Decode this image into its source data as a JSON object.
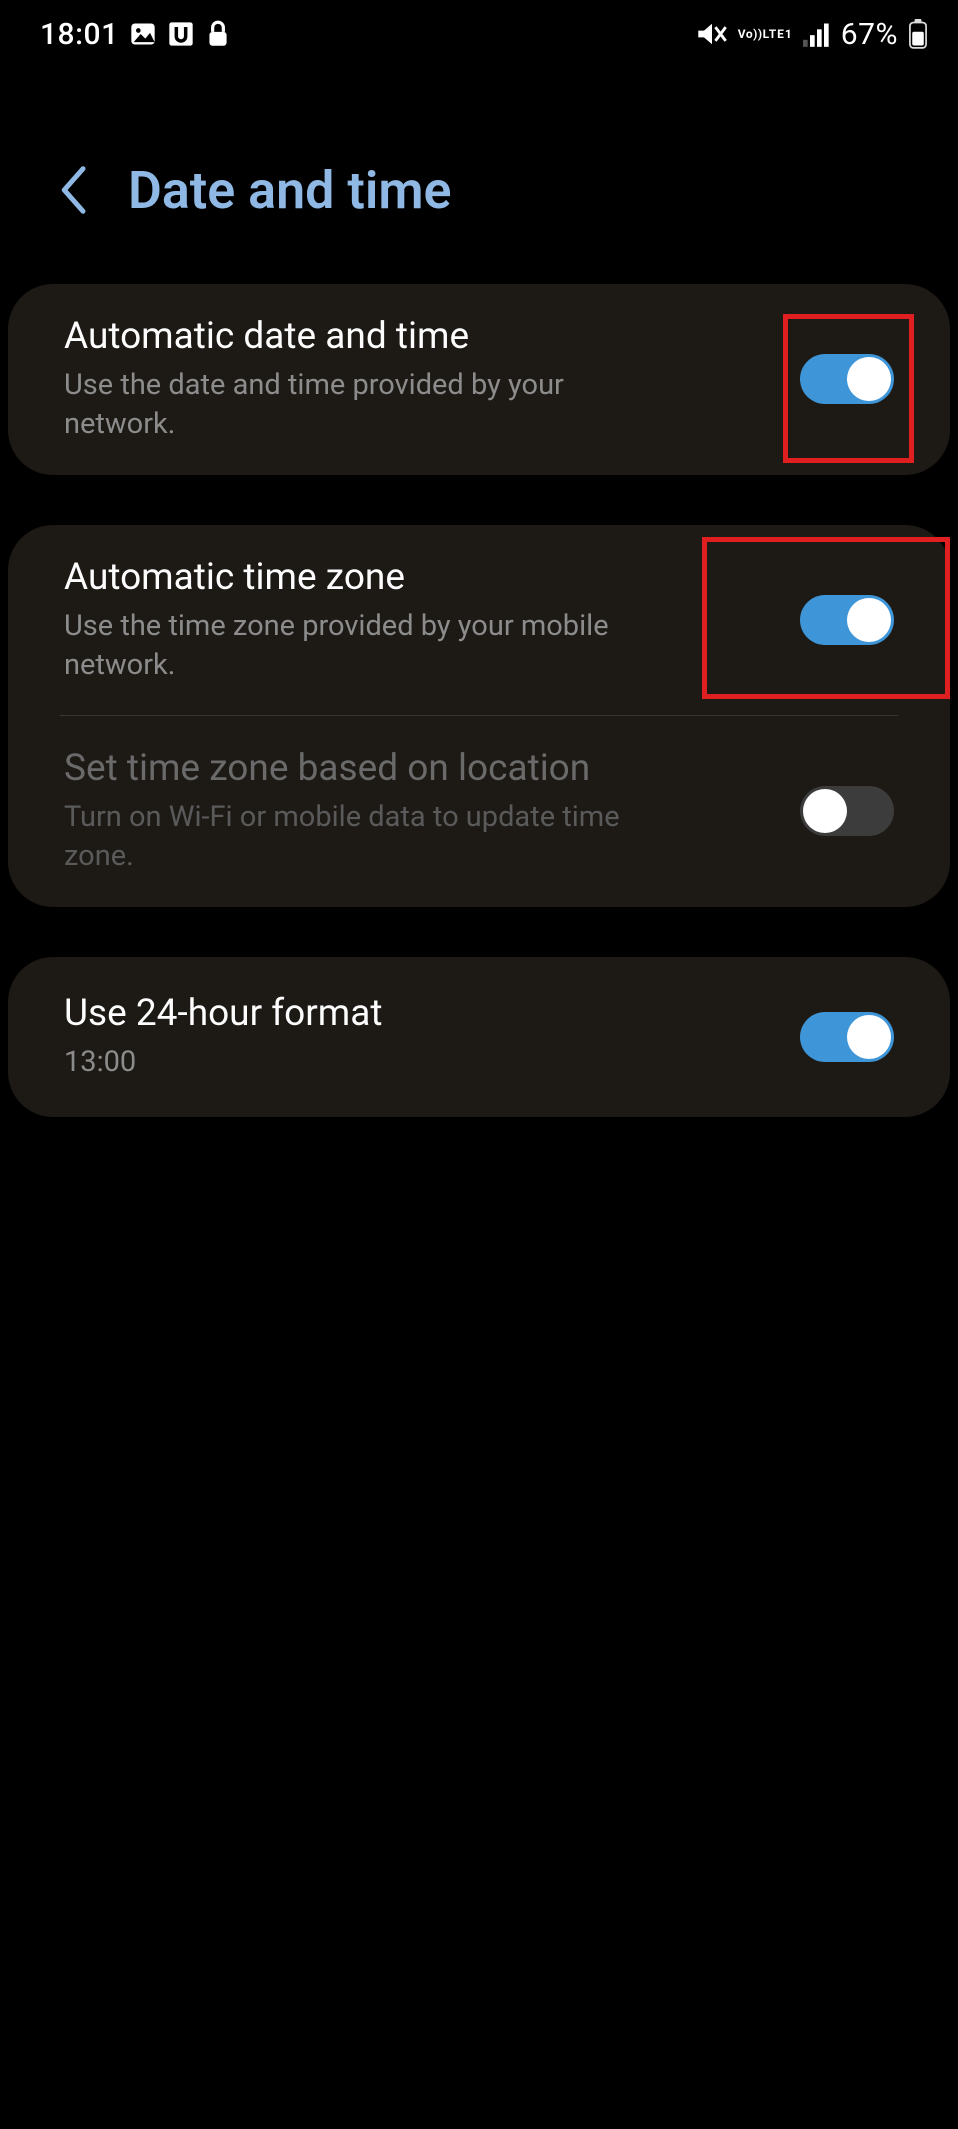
{
  "status": {
    "time": "18:01",
    "icons_left": [
      "picture-icon",
      "u-box-icon",
      "lock-icon"
    ],
    "icons_right": [
      "mute-icon",
      "volte-icon",
      "signal-icon"
    ],
    "battery_pct": "67%"
  },
  "header": {
    "title": "Date and time"
  },
  "rows": {
    "auto_dt": {
      "title": "Automatic date and time",
      "sub": "Use the date and time provided by your network.",
      "on": true
    },
    "auto_tz": {
      "title": "Automatic time zone",
      "sub": "Use the time zone provided by your mobile network.",
      "on": true
    },
    "loc_tz": {
      "title": "Set time zone based on location",
      "sub": "Turn on Wi-Fi or mobile data to update time zone.",
      "on": false,
      "disabled": true
    },
    "h24": {
      "title": "Use 24-hour format",
      "sub": "13:00",
      "on": true
    }
  }
}
